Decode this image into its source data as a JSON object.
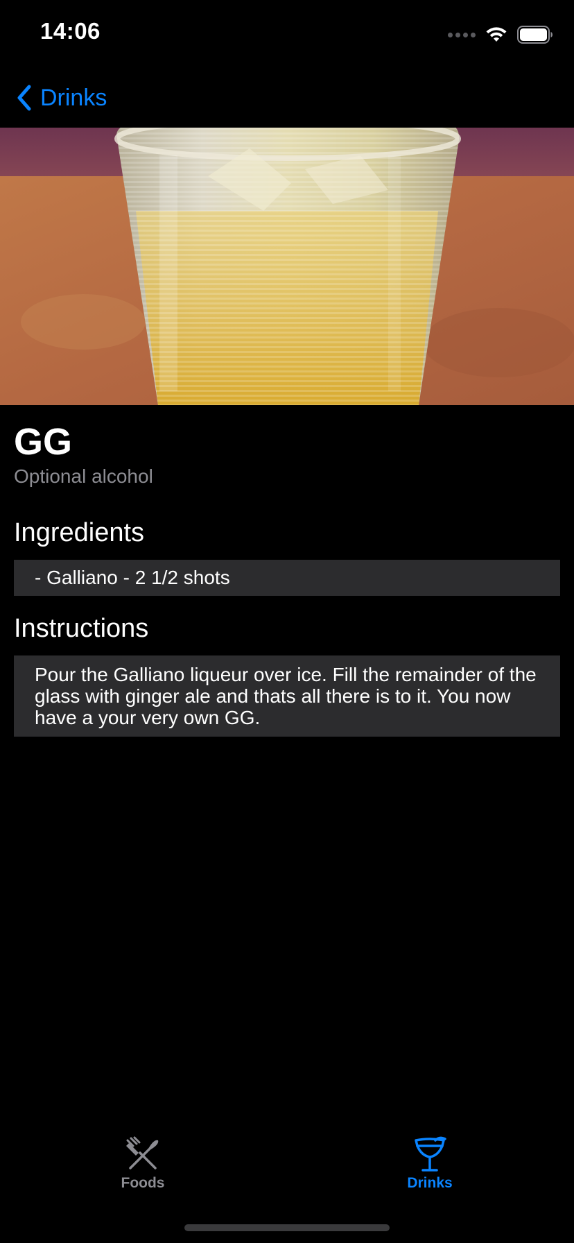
{
  "status_bar": {
    "time": "14:06",
    "icons": [
      "cellular-signal-icon",
      "wifi-icon",
      "battery-icon"
    ]
  },
  "nav": {
    "back_label": "Drinks",
    "back_icon": "chevron-left-icon"
  },
  "drink": {
    "name": "GG",
    "category": "Optional alcohol",
    "image": "glass-of-galliano-on-ice-photo",
    "ingredients_heading": "Ingredients",
    "ingredients": [
      "- Galliano - 2 1/2 shots"
    ],
    "instructions_heading": "Instructions",
    "instructions": "Pour the Galliano liqueur over ice. Fill the remainder of the glass with ginger ale and thats all there is to it. You now have a your very own GG."
  },
  "tabs": [
    {
      "label": "Foods",
      "icon": "fork-knife-icon",
      "selected": false
    },
    {
      "label": "Drinks",
      "icon": "cocktail-glass-icon",
      "selected": true
    }
  ],
  "colors": {
    "accent": "#0a84ff",
    "background": "#000000",
    "card": "#2c2c2e",
    "secondary_text": "#8d8d93"
  }
}
